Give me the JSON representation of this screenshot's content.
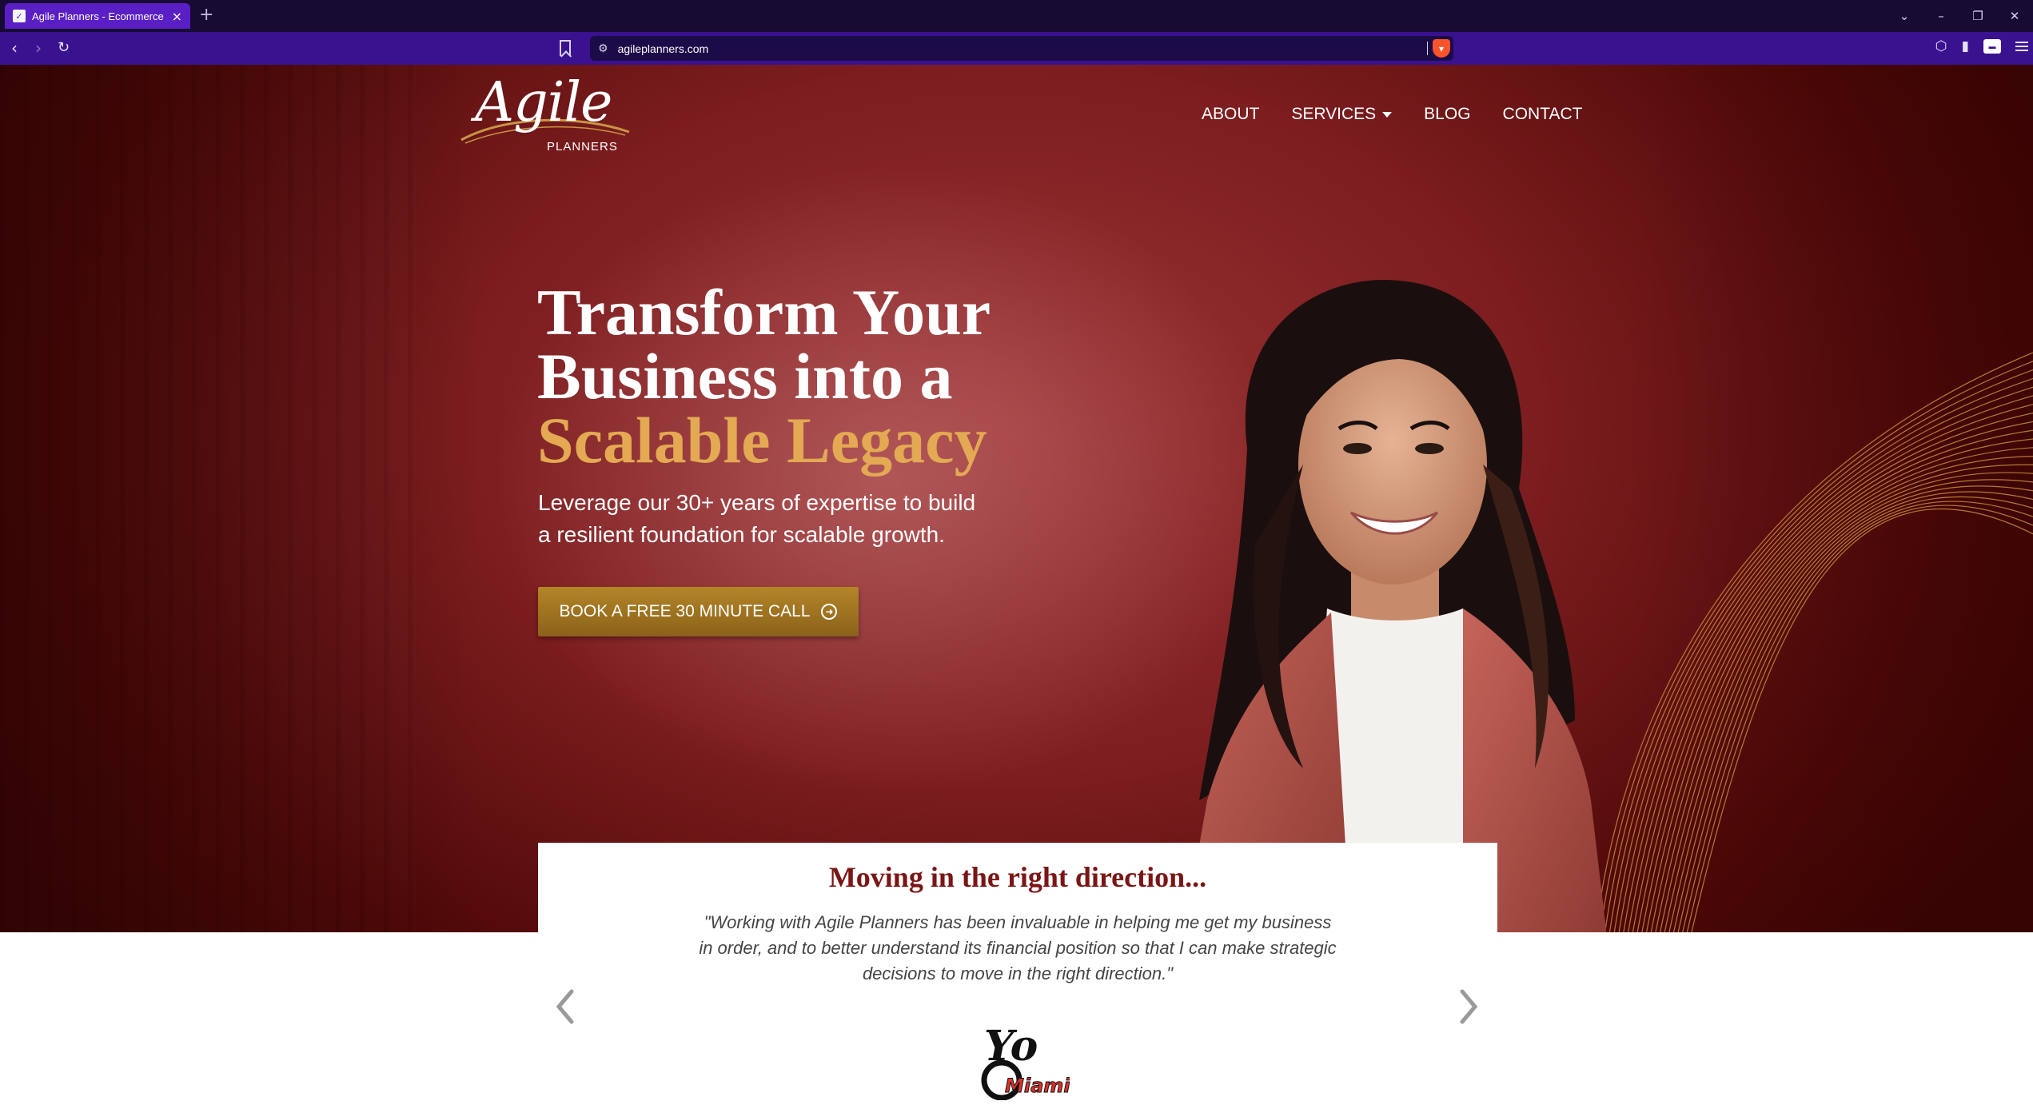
{
  "browser": {
    "tab_title": "Agile Planners - Ecommerce B",
    "new_tab_symbol": "+",
    "url": "agileplanners.com"
  },
  "site": {
    "logo": {
      "script": "Agile",
      "subtitle": "PLANNERS"
    },
    "nav": [
      "ABOUT",
      "SERVICES",
      "BLOG",
      "CONTACT"
    ]
  },
  "hero": {
    "headline_line1": "Transform Your",
    "headline_line2": "Business into a",
    "headline_highlight": "Scalable Legacy",
    "subtext_line1": "Leverage our 30+ years of expertise to build",
    "subtext_line2": "a resilient foundation for scalable growth.",
    "cta_label": "BOOK A FREE 30 MINUTE CALL"
  },
  "testimonial": {
    "title": "Moving in the right direction...",
    "quote": "\"Working with Agile Planners has been invaluable in helping me get my business in order, and to better understand its financial position so that I can make strategic decisions to move in the right direction.\"",
    "client_logo": {
      "main": "Yo",
      "sub": "Miami"
    }
  },
  "colors": {
    "tab_active": "#5a1fc4",
    "address_bar": "#3a1290",
    "hero_red": "#7c1d1f",
    "gold": "#e3a953",
    "cta_gold": "#a47822",
    "testimonial_title": "#7a1616"
  },
  "icons": [
    "favicon-icon",
    "close-icon",
    "back-icon",
    "forward-icon",
    "reload-icon",
    "bookmark-icon",
    "site-settings-icon",
    "brave-shield-icon",
    "chevron-down-icon",
    "minimize-icon",
    "restore-icon",
    "window-close-icon",
    "arrow-circle-right-icon",
    "chevron-left-icon",
    "chevron-right-icon"
  ]
}
